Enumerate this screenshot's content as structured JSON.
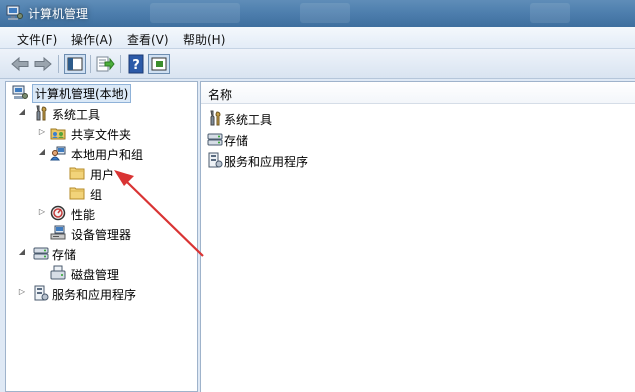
{
  "window": {
    "title": "计算机管理",
    "app_icon": "computer-management-icon"
  },
  "menu": {
    "items": [
      "文件(F)",
      "操作(A)",
      "查看(V)",
      "帮助(H)"
    ]
  },
  "toolbar": {
    "buttons": [
      "back-arrow-icon",
      "forward-arrow-icon",
      "show-hide-console-tree-icon",
      "export-list-icon",
      "help-icon",
      "show-hide-action-pane-icon"
    ]
  },
  "tree": {
    "root": "计算机管理(本地)",
    "system_tools": "系统工具",
    "shared_folders": "共享文件夹",
    "local_users_groups": "本地用户和组",
    "users": "用户",
    "groups": "组",
    "performance": "性能",
    "device_manager": "设备管理器",
    "storage": "存储",
    "disk_management": "磁盘管理",
    "services_apps": "服务和应用程序"
  },
  "list": {
    "header": "名称",
    "items": [
      "系统工具",
      "存储",
      "服务和应用程序"
    ]
  },
  "annotation": {
    "arrow_color": "#d93434"
  }
}
